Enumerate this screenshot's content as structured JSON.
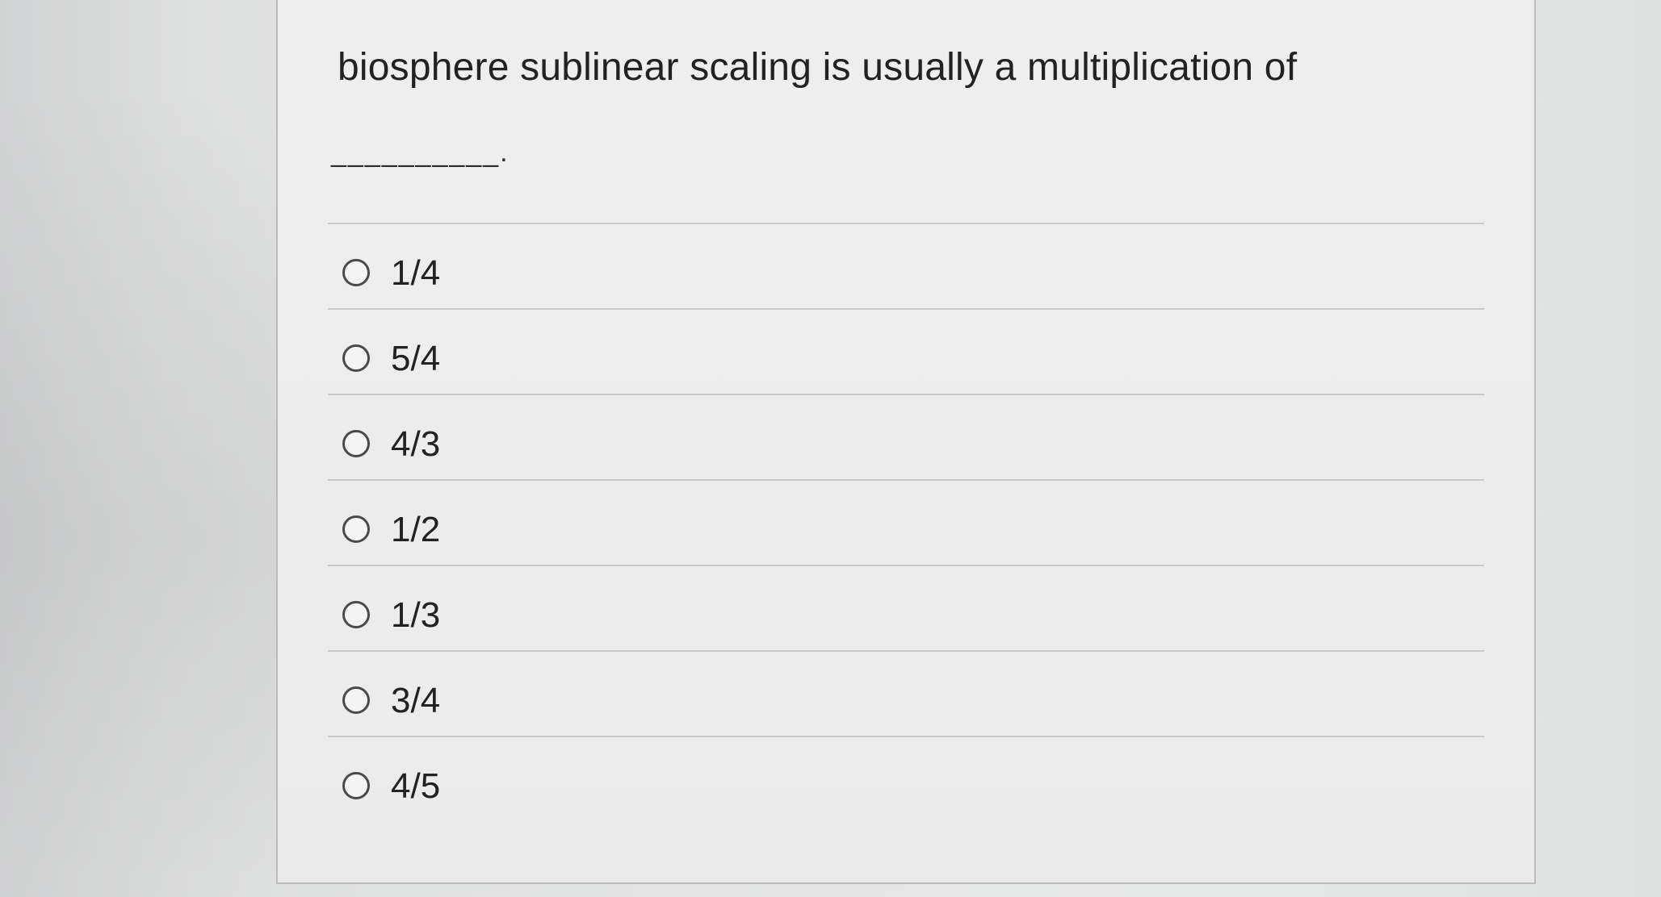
{
  "question": {
    "text": "biosphere sublinear scaling is usually a multiplication of",
    "blank": "__________."
  },
  "answers": [
    {
      "label": "1/4"
    },
    {
      "label": "5/4"
    },
    {
      "label": "4/3"
    },
    {
      "label": "1/2"
    },
    {
      "label": "1/3"
    },
    {
      "label": "3/4"
    },
    {
      "label": "4/5"
    }
  ]
}
